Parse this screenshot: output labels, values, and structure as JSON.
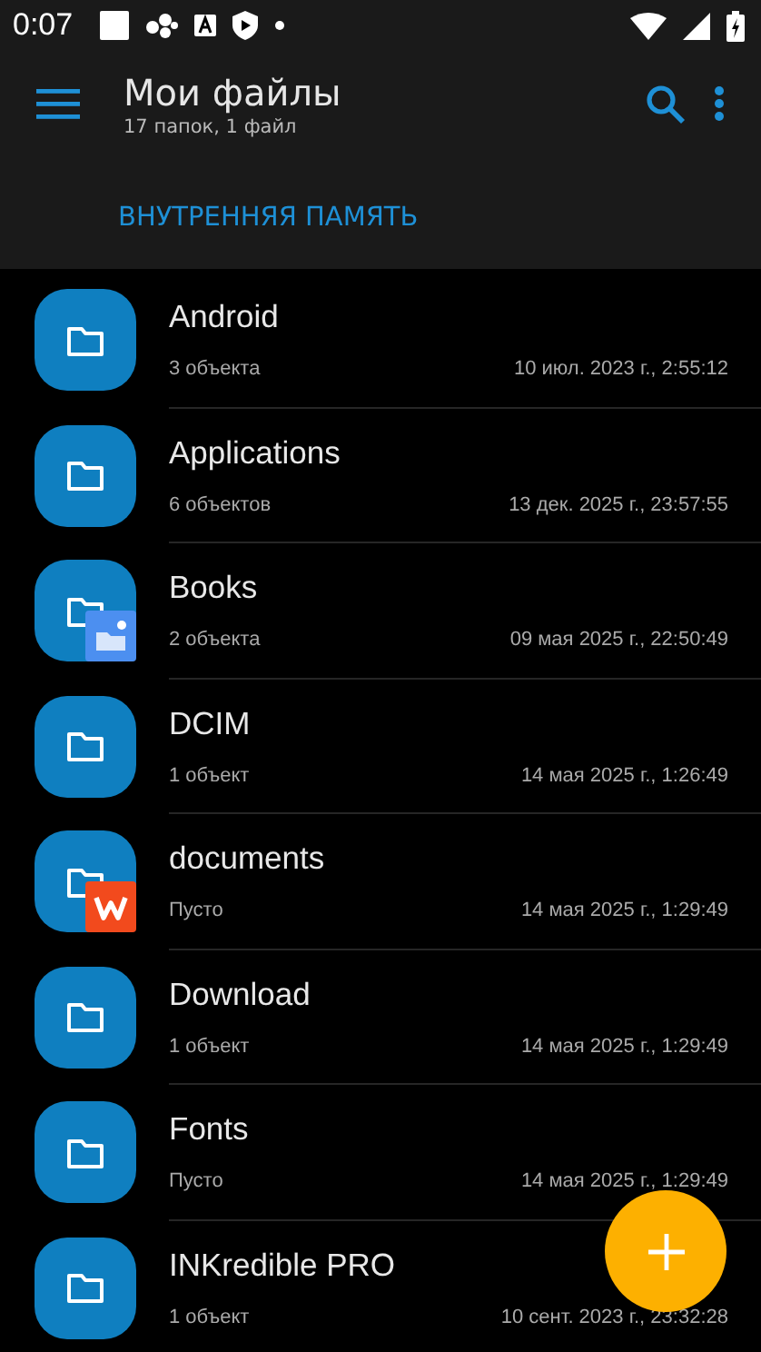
{
  "status_bar": {
    "time": "0:07"
  },
  "app_bar": {
    "title": "Мои файлы",
    "subtitle": "17 папок, 1 файл"
  },
  "breadcrumb": "ВНУТРЕННЯЯ ПАМЯТЬ",
  "folders": [
    {
      "name": "Android",
      "count": "3 объекта",
      "date": "10 июл. 2023 г., 2:55:12",
      "kind": "plain"
    },
    {
      "name": "Applications",
      "count": "6 объектов",
      "date": "13 дек. 2025 г., 23:57:55",
      "kind": "plain"
    },
    {
      "name": "Books",
      "count": "2 объекта",
      "date": "09 мая 2025 г., 22:50:49",
      "kind": "gallery"
    },
    {
      "name": "DCIM",
      "count": "1 объект",
      "date": "14 мая 2025 г., 1:26:49",
      "kind": "plain"
    },
    {
      "name": "documents",
      "count": "Пусто",
      "date": "14 мая 2025 г., 1:29:49",
      "kind": "office"
    },
    {
      "name": "Download",
      "count": "1 объект",
      "date": "14 мая 2025 г., 1:29:49",
      "kind": "plain"
    },
    {
      "name": "Fonts",
      "count": "Пусто",
      "date": "14 мая 2025 г., 1:29:49",
      "kind": "plain"
    },
    {
      "name": "INKredible PRO",
      "count": "1 объект",
      "date": "10 сент. 2023 г., 23:32:28",
      "kind": "plain"
    }
  ]
}
